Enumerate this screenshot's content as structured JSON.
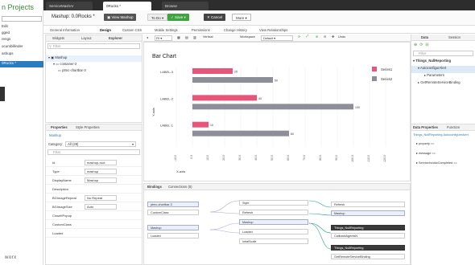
{
  "app": {
    "title": "n Projects",
    "footer": "worx"
  },
  "left_nav": {
    "items": [
      {
        "label": "Edit",
        "selected": false
      },
      {
        "label": "gged",
        "selected": false
      },
      {
        "label": "rengs",
        "selected": false
      },
      {
        "label": "ocumbillinder",
        "selected": false
      },
      {
        "label": "ashups",
        "selected": false
      },
      {
        "label": "0Rocks *",
        "selected": true
      }
    ]
  },
  "top_tabs": [
    {
      "label": "ServiceMashAr",
      "active": false
    },
    {
      "label": "0Rocks *",
      "active": true
    },
    {
      "label": "Browse",
      "active": false
    }
  ],
  "toolbar": {
    "title": "Mashup: 0.0Rocks *",
    "view_label": "View Mashup",
    "todo_label": "To Do",
    "save_label": "Save",
    "cancel_label": "Cancel",
    "more_label": "More"
  },
  "subtabs": [
    {
      "label": "General Information",
      "active": false
    },
    {
      "label": "Design",
      "active": true
    },
    {
      "label": "Custom CSS",
      "active": false
    },
    {
      "label": "Mobile Settings",
      "active": false
    },
    {
      "label": "Permissions",
      "active": false
    },
    {
      "label": "Change History",
      "active": false
    },
    {
      "label": "View Relationships",
      "active": false
    }
  ],
  "explorer": {
    "tabs": [
      "Widgets",
      "Layout",
      "Explorer"
    ],
    "filter_placeholder": "Filter",
    "tree": [
      {
        "label": "Mashup",
        "level": 0
      },
      {
        "label": "container-2",
        "level": 1
      },
      {
        "label": "ptmc-chartbar-3",
        "level": 2
      }
    ]
  },
  "properties": {
    "tabs": [
      "Properties",
      "Style Properties"
    ],
    "subtitle": "Mashup",
    "category_label": "Category:",
    "category_value": "All (28)",
    "filter_placeholder": "Filter",
    "rows": [
      {
        "name": "Id",
        "value": "mashup-root"
      },
      {
        "name": "Type",
        "value": "mashup"
      },
      {
        "name": "DisplayName",
        "value": "Mashup"
      },
      {
        "name": "Description",
        "value": ""
      },
      {
        "name": "BGImageRepeat",
        "value": "No Repeat"
      },
      {
        "name": "BGImageSize",
        "value": "Auto"
      },
      {
        "name": "CloseIfPopup",
        "value": ""
      },
      {
        "name": "CustomClass",
        "value": ""
      },
      {
        "name": "Loaded",
        "value": ""
      }
    ]
  },
  "canvas_toolbar": {
    "zoom": "Fit",
    "mode": "Vertical",
    "workspace_label": "Workspace",
    "workspace_value": "Default",
    "undo": "Undo"
  },
  "chart_data": {
    "type": "bar",
    "title": "Bar Chart",
    "categories": [
      "LABEL-3",
      "LABEL-2",
      "LABEL-1"
    ],
    "series": [
      {
        "name": "Series1",
        "color": "#e8547a",
        "values": [
          25,
          40,
          10
        ]
      },
      {
        "name": "Series2",
        "color": "#8e8e99",
        "values": [
          50,
          100,
          60
        ]
      }
    ],
    "xlabel": "X-axis",
    "ylabel": "Y-axis",
    "xlim": [
      -10,
      120
    ],
    "xticks": [
      "-10.0",
      "0.0",
      "10.0",
      "20.0",
      "30.0",
      "40.0",
      "50.0",
      "60.0",
      "70.0",
      "80.0",
      "90.0",
      "100.0",
      "110.0",
      "120.0"
    ],
    "grid": true,
    "legend": "top-right",
    "orientation": "horizontal"
  },
  "bindings_panel": {
    "tabs": [
      "Bindings",
      "Connections (5)"
    ],
    "left_nodes": [
      {
        "label": "ptmc-chartbar-3"
      },
      {
        "label": "CustomClass"
      },
      {
        "label": "Mashup"
      },
      {
        "label": "Loaded"
      }
    ],
    "mid_nodes": [
      {
        "label": "Style"
      },
      {
        "label": "Refresh"
      },
      {
        "label": "Mashup"
      },
      {
        "label": "Loaded"
      },
      {
        "label": "InitalScale"
      }
    ],
    "right_nodes": [
      {
        "label": "Refresh"
      },
      {
        "label": "Mashup"
      },
      {
        "label": "Things_NullReporting"
      },
      {
        "label": "CallbackAgentsN"
      },
      {
        "label": "Things_NullReporting"
      },
      {
        "label": "GetRemoteServiceBinding"
      }
    ]
  },
  "data_panel": {
    "tabs": [
      "Data",
      "Session"
    ],
    "filter_placeholder": "Filter",
    "tree": [
      {
        "label": "Things_NullReporting"
      },
      {
        "label": "AutoconfigurAlert"
      },
      {
        "label": "Parameters"
      },
      {
        "label": "GetRemoteServiceBinding"
      }
    ]
  },
  "data_properties": {
    "tabs": [
      "Data Properties",
      "Function"
    ],
    "subtitle": "Things_NullReporting.AutoconfigureAlert",
    "rows": [
      {
        "name": "property ==",
        "value": ""
      },
      {
        "name": "message ==",
        "value": ""
      },
      {
        "name": "ServiceInvokeCompleted ==",
        "value": ""
      }
    ]
  }
}
